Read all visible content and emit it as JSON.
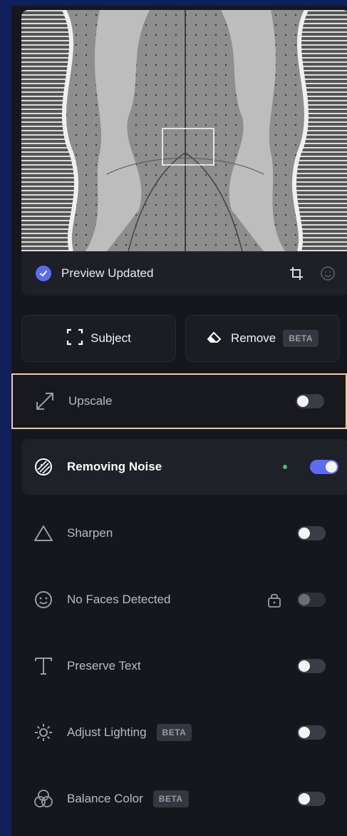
{
  "preview": {
    "status": "Preview Updated",
    "icons": [
      "check-circle-icon",
      "crop-icon",
      "face-icon"
    ]
  },
  "modes": {
    "subject_label": "Subject",
    "remove_label": "Remove",
    "remove_badge": "BETA"
  },
  "settings": [
    {
      "id": "upscale",
      "label": "Upscale",
      "icon": "expand-arrow-icon",
      "enabled": false,
      "highlighted": true
    },
    {
      "id": "noise",
      "label": "Removing Noise",
      "icon": "noise-icon",
      "enabled": true,
      "active": true
    },
    {
      "id": "sharpen",
      "label": "Sharpen",
      "icon": "triangle-icon",
      "enabled": false
    },
    {
      "id": "faces",
      "label": "No Faces Detected",
      "icon": "face-icon",
      "enabled": false,
      "locked": true
    },
    {
      "id": "text",
      "label": "Preserve Text",
      "icon": "text-icon",
      "enabled": false
    },
    {
      "id": "lighting",
      "label": "Adjust Lighting",
      "icon": "sun-icon",
      "badge": "BETA",
      "enabled": false
    },
    {
      "id": "color",
      "label": "Balance Color",
      "icon": "color-circles-icon",
      "badge": "BETA",
      "enabled": false
    }
  ],
  "colors": {
    "accent": "#5b6cf2",
    "highlight_border": "#f5c7a3",
    "status_dot": "#3ec46d"
  }
}
